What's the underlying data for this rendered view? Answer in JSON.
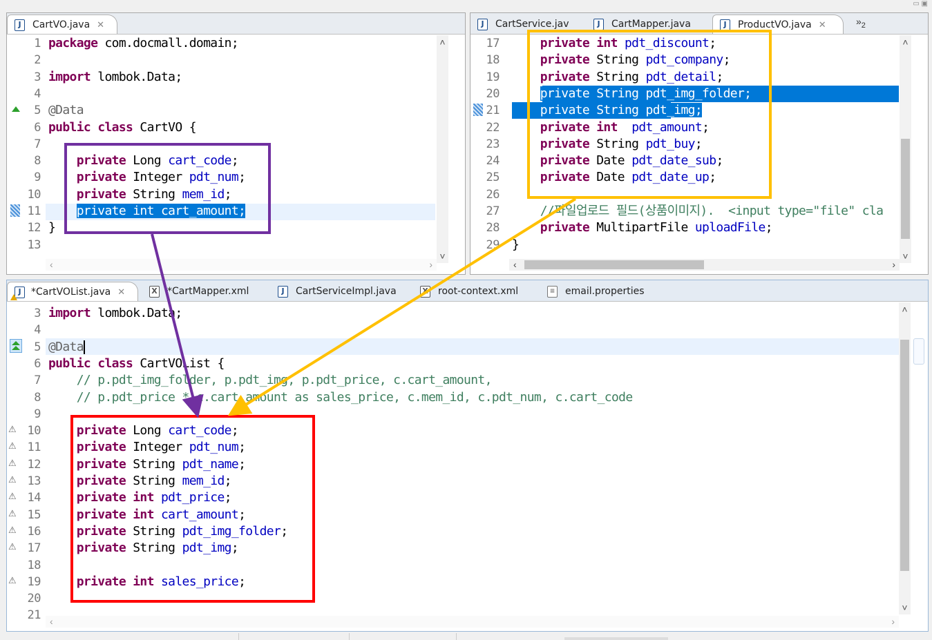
{
  "window": {
    "top_right_icons": "▭ ▣"
  },
  "top_left": {
    "tabs": [
      {
        "label": "CartVO.java",
        "close": "✕",
        "icon": "java-file-icon"
      }
    ],
    "lines": [
      {
        "n": "1",
        "tokens": [
          {
            "t": "package",
            "c": "kw"
          },
          {
            "t": " com.docmall.domain;",
            "c": ""
          }
        ]
      },
      {
        "n": "2",
        "tokens": []
      },
      {
        "n": "3",
        "tokens": [
          {
            "t": "import",
            "c": "kw"
          },
          {
            "t": " lombok.Data;",
            "c": ""
          }
        ]
      },
      {
        "n": "4",
        "tokens": []
      },
      {
        "n": "5",
        "tokens": [
          {
            "t": "@Data",
            "c": "an"
          }
        ]
      },
      {
        "n": "6",
        "tokens": [
          {
            "t": "public",
            "c": "kw"
          },
          {
            "t": " ",
            "c": ""
          },
          {
            "t": "class",
            "c": "kw"
          },
          {
            "t": " CartVO {",
            "c": ""
          }
        ]
      },
      {
        "n": "7",
        "tokens": []
      },
      {
        "n": "8",
        "tokens": [
          {
            "t": "    ",
            "c": ""
          },
          {
            "t": "private",
            "c": "kw"
          },
          {
            "t": " Long ",
            "c": ""
          },
          {
            "t": "cart_code",
            "c": "fd"
          },
          {
            "t": ";",
            "c": ""
          }
        ]
      },
      {
        "n": "9",
        "tokens": [
          {
            "t": "    ",
            "c": ""
          },
          {
            "t": "private",
            "c": "kw"
          },
          {
            "t": " Integer ",
            "c": ""
          },
          {
            "t": "pdt_num",
            "c": "fd"
          },
          {
            "t": ";",
            "c": ""
          }
        ]
      },
      {
        "n": "10",
        "tokens": [
          {
            "t": "    ",
            "c": ""
          },
          {
            "t": "private",
            "c": "kw"
          },
          {
            "t": " String ",
            "c": ""
          },
          {
            "t": "mem_id",
            "c": "fd"
          },
          {
            "t": ";",
            "c": ""
          }
        ]
      },
      {
        "n": "11",
        "tokens": [
          {
            "t": "    ",
            "c": ""
          },
          {
            "t": "private int cart_amount;",
            "c": "selwhole"
          }
        ]
      },
      {
        "n": "12",
        "tokens": [
          {
            "t": "}",
            "c": ""
          }
        ]
      },
      {
        "n": "13",
        "tokens": []
      }
    ]
  },
  "top_right": {
    "tabs": [
      {
        "label": "CartService.jav",
        "icon": "java-file-icon"
      },
      {
        "label": "CartMapper.java",
        "icon": "java-file-icon"
      },
      {
        "label": "ProductVO.java",
        "close": "✕",
        "icon": "java-file-icon"
      }
    ],
    "overflow": "»",
    "overflow_count": "2",
    "lines": [
      {
        "n": "17",
        "tokens": [
          {
            "t": "    ",
            "c": ""
          },
          {
            "t": "private",
            "c": "kw"
          },
          {
            "t": " ",
            "c": ""
          },
          {
            "t": "int",
            "c": "kw"
          },
          {
            "t": " ",
            "c": ""
          },
          {
            "t": "pdt_discount",
            "c": "fd"
          },
          {
            "t": ";",
            "c": ""
          }
        ]
      },
      {
        "n": "18",
        "tokens": [
          {
            "t": "    ",
            "c": ""
          },
          {
            "t": "private",
            "c": "kw"
          },
          {
            "t": " String ",
            "c": ""
          },
          {
            "t": "pdt_company",
            "c": "fd"
          },
          {
            "t": ";",
            "c": ""
          }
        ]
      },
      {
        "n": "19",
        "tokens": [
          {
            "t": "    ",
            "c": ""
          },
          {
            "t": "private",
            "c": "kw"
          },
          {
            "t": " String ",
            "c": ""
          },
          {
            "t": "pdt_detail",
            "c": "fd"
          },
          {
            "t": ";",
            "c": ""
          }
        ]
      },
      {
        "n": "20",
        "tokens": [
          {
            "t": "    ",
            "c": ""
          },
          {
            "t": "private String pdt_img_folder;",
            "c": "selwhole"
          }
        ]
      },
      {
        "n": "21",
        "tokens": [
          {
            "t": "    private String pdt_img;",
            "c": "selwhole"
          }
        ]
      },
      {
        "n": "22",
        "tokens": [
          {
            "t": "    ",
            "c": ""
          },
          {
            "t": "private",
            "c": "kw"
          },
          {
            "t": " ",
            "c": ""
          },
          {
            "t": "int",
            "c": "kw"
          },
          {
            "t": "  ",
            "c": ""
          },
          {
            "t": "pdt_amount",
            "c": "fd"
          },
          {
            "t": ";",
            "c": ""
          }
        ]
      },
      {
        "n": "23",
        "tokens": [
          {
            "t": "    ",
            "c": ""
          },
          {
            "t": "private",
            "c": "kw"
          },
          {
            "t": " String ",
            "c": ""
          },
          {
            "t": "pdt_buy",
            "c": "fd"
          },
          {
            "t": ";",
            "c": ""
          }
        ]
      },
      {
        "n": "24",
        "tokens": [
          {
            "t": "    ",
            "c": ""
          },
          {
            "t": "private",
            "c": "kw"
          },
          {
            "t": " Date ",
            "c": ""
          },
          {
            "t": "pdt_date_sub",
            "c": "fd"
          },
          {
            "t": ";",
            "c": ""
          }
        ]
      },
      {
        "n": "25",
        "tokens": [
          {
            "t": "    ",
            "c": ""
          },
          {
            "t": "private",
            "c": "kw"
          },
          {
            "t": " Date ",
            "c": ""
          },
          {
            "t": "pdt_date_up",
            "c": "fd"
          },
          {
            "t": ";",
            "c": ""
          }
        ]
      },
      {
        "n": "26",
        "tokens": []
      },
      {
        "n": "27",
        "tokens": [
          {
            "t": "    ",
            "c": ""
          },
          {
            "t": "//파일업로드 필드(상품이미지).  <input type=\"file\" cla",
            "c": "cm"
          }
        ]
      },
      {
        "n": "28",
        "tokens": [
          {
            "t": "    ",
            "c": ""
          },
          {
            "t": "private",
            "c": "kw"
          },
          {
            "t": " MultipartFile ",
            "c": ""
          },
          {
            "t": "uploadFile",
            "c": "fd"
          },
          {
            "t": ";",
            "c": ""
          }
        ]
      },
      {
        "n": "29",
        "tokens": [
          {
            "t": "}",
            "c": ""
          }
        ]
      }
    ]
  },
  "bottom": {
    "tabs": [
      {
        "label": "*CartVOList.java",
        "close": "✕",
        "icon": "java-file-icon"
      },
      {
        "label": "*CartMapper.xml",
        "icon": "xml-file-icon"
      },
      {
        "label": "CartServiceImpl.java",
        "icon": "java-file-icon"
      },
      {
        "label": "root-context.xml",
        "icon": "xml-file-icon"
      },
      {
        "label": "email.properties",
        "icon": "properties-file-icon"
      }
    ],
    "lines": [
      {
        "n": "3",
        "tokens": [
          {
            "t": "import",
            "c": "kw"
          },
          {
            "t": " lombok.Data;",
            "c": ""
          }
        ]
      },
      {
        "n": "4",
        "tokens": []
      },
      {
        "n": "5",
        "tokens": [
          {
            "t": "@Data",
            "c": "an"
          }
        ]
      },
      {
        "n": "6",
        "tokens": [
          {
            "t": "public",
            "c": "kw"
          },
          {
            "t": " ",
            "c": ""
          },
          {
            "t": "class",
            "c": "kw"
          },
          {
            "t": " CartVOList {",
            "c": ""
          }
        ]
      },
      {
        "n": "7",
        "tokens": [
          {
            "t": "    // p.pdt_img_folder, p.pdt_img, p.pdt_price, c.cart_amount,",
            "c": "cm"
          }
        ]
      },
      {
        "n": "8",
        "tokens": [
          {
            "t": "    // p.pdt_price * c.cart_amount as sales_price, c.mem_id, c.pdt_num, c.cart_code",
            "c": "cm"
          }
        ]
      },
      {
        "n": "9",
        "tokens": []
      },
      {
        "n": "10",
        "tokens": [
          {
            "t": "    ",
            "c": ""
          },
          {
            "t": "private",
            "c": "kw"
          },
          {
            "t": " Long ",
            "c": ""
          },
          {
            "t": "cart_code",
            "c": "fd"
          },
          {
            "t": ";",
            "c": ""
          }
        ]
      },
      {
        "n": "11",
        "tokens": [
          {
            "t": "    ",
            "c": ""
          },
          {
            "t": "private",
            "c": "kw"
          },
          {
            "t": " Integer ",
            "c": ""
          },
          {
            "t": "pdt_num",
            "c": "fd"
          },
          {
            "t": ";",
            "c": ""
          }
        ]
      },
      {
        "n": "12",
        "tokens": [
          {
            "t": "    ",
            "c": ""
          },
          {
            "t": "private",
            "c": "kw"
          },
          {
            "t": " String ",
            "c": ""
          },
          {
            "t": "pdt_name",
            "c": "fd"
          },
          {
            "t": ";",
            "c": ""
          }
        ]
      },
      {
        "n": "13",
        "tokens": [
          {
            "t": "    ",
            "c": ""
          },
          {
            "t": "private",
            "c": "kw"
          },
          {
            "t": " String ",
            "c": ""
          },
          {
            "t": "mem_id",
            "c": "fd"
          },
          {
            "t": ";",
            "c": ""
          }
        ]
      },
      {
        "n": "14",
        "tokens": [
          {
            "t": "    ",
            "c": ""
          },
          {
            "t": "private",
            "c": "kw"
          },
          {
            "t": " ",
            "c": ""
          },
          {
            "t": "int",
            "c": "kw"
          },
          {
            "t": " ",
            "c": ""
          },
          {
            "t": "pdt_price",
            "c": "fd"
          },
          {
            "t": ";",
            "c": ""
          }
        ]
      },
      {
        "n": "15",
        "tokens": [
          {
            "t": "    ",
            "c": ""
          },
          {
            "t": "private",
            "c": "kw"
          },
          {
            "t": " ",
            "c": ""
          },
          {
            "t": "int",
            "c": "kw"
          },
          {
            "t": " ",
            "c": ""
          },
          {
            "t": "cart_amount",
            "c": "fd"
          },
          {
            "t": ";",
            "c": ""
          }
        ]
      },
      {
        "n": "16",
        "tokens": [
          {
            "t": "    ",
            "c": ""
          },
          {
            "t": "private",
            "c": "kw"
          },
          {
            "t": " String ",
            "c": ""
          },
          {
            "t": "pdt_img_folder",
            "c": "fd"
          },
          {
            "t": ";",
            "c": ""
          }
        ]
      },
      {
        "n": "17",
        "tokens": [
          {
            "t": "    ",
            "c": ""
          },
          {
            "t": "private",
            "c": "kw"
          },
          {
            "t": " String ",
            "c": ""
          },
          {
            "t": "pdt_img",
            "c": "fd"
          },
          {
            "t": ";",
            "c": ""
          }
        ]
      },
      {
        "n": "18",
        "tokens": []
      },
      {
        "n": "19",
        "tokens": [
          {
            "t": "    ",
            "c": ""
          },
          {
            "t": "private",
            "c": "kw"
          },
          {
            "t": " ",
            "c": ""
          },
          {
            "t": "int",
            "c": "kw"
          },
          {
            "t": " ",
            "c": ""
          },
          {
            "t": "sales_price",
            "c": "fd"
          },
          {
            "t": ";",
            "c": ""
          }
        ]
      },
      {
        "n": "20",
        "tokens": []
      },
      {
        "n": "21",
        "tokens": []
      }
    ],
    "warning_icon": "⚠"
  },
  "colors": {
    "purple_box": "#7030a0",
    "yellow_box": "#ffc000",
    "red_box": "#ff0000",
    "selection": "#0078d7",
    "keyword": "#7f0055",
    "field": "#0000c0",
    "comment": "#3f7f5f"
  }
}
